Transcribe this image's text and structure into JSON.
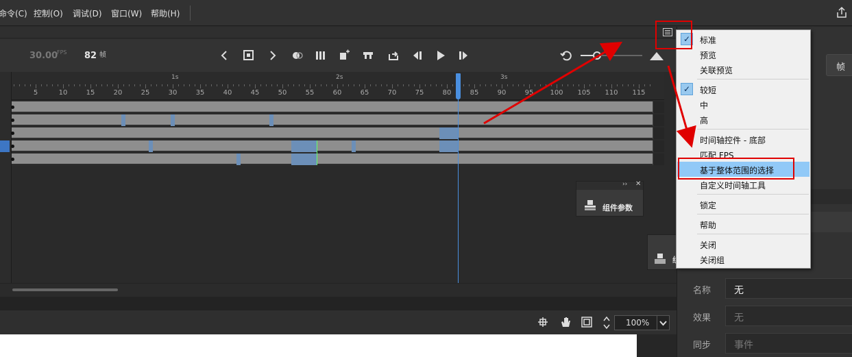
{
  "menubar": {
    "items": [
      "命令(C)",
      "控制(O)",
      "调试(D)",
      "窗口(W)",
      "帮助(H)"
    ]
  },
  "toolbar": {
    "fps_value": "30.00",
    "fps_unit": "FPS",
    "frame_number": "82",
    "frame_unit": "帧"
  },
  "ruler": {
    "seconds": [
      "1s",
      "2s",
      "3s"
    ],
    "ticks": [
      "5",
      "10",
      "15",
      "20",
      "25",
      "30",
      "35",
      "40",
      "45",
      "50",
      "55",
      "60",
      "65",
      "70",
      "75",
      "80",
      "85",
      "90",
      "95",
      "100",
      "105",
      "110",
      "115"
    ]
  },
  "panels": {
    "component_params": "组件参数",
    "panel2_partial": "组"
  },
  "bottom": {
    "zoom": "100%"
  },
  "properties": {
    "top_right_partial": "帧",
    "rows": [
      {
        "label": "名称",
        "value": "无"
      },
      {
        "label": "效果",
        "value": "无"
      },
      {
        "label": "同步",
        "value": "事件"
      }
    ]
  },
  "context_menu": {
    "items": [
      {
        "label": "标准",
        "checked": true
      },
      {
        "label": "预览",
        "checked": false
      },
      {
        "label": "关联预览",
        "checked": false
      },
      {
        "label": "较短",
        "checked": true
      },
      {
        "label": "中",
        "checked": false
      },
      {
        "label": "高",
        "checked": false
      },
      {
        "label": "时间轴控件 - 底部",
        "checked": false
      },
      {
        "label": "匹配 FPS",
        "checked": false
      },
      {
        "label": "基于整体范围的选择",
        "checked": false,
        "highlighted": true
      },
      {
        "label": "自定义时间轴工具",
        "checked": false
      },
      {
        "label": "锁定",
        "checked": false
      },
      {
        "label": "帮助",
        "checked": false
      },
      {
        "label": "关闭",
        "checked": false
      },
      {
        "label": "关闭组",
        "checked": false
      }
    ]
  },
  "colors": {
    "annotation_red": "#e00000",
    "playhead_blue": "#4a8fe0",
    "highlight_blue": "#91c9f7"
  }
}
